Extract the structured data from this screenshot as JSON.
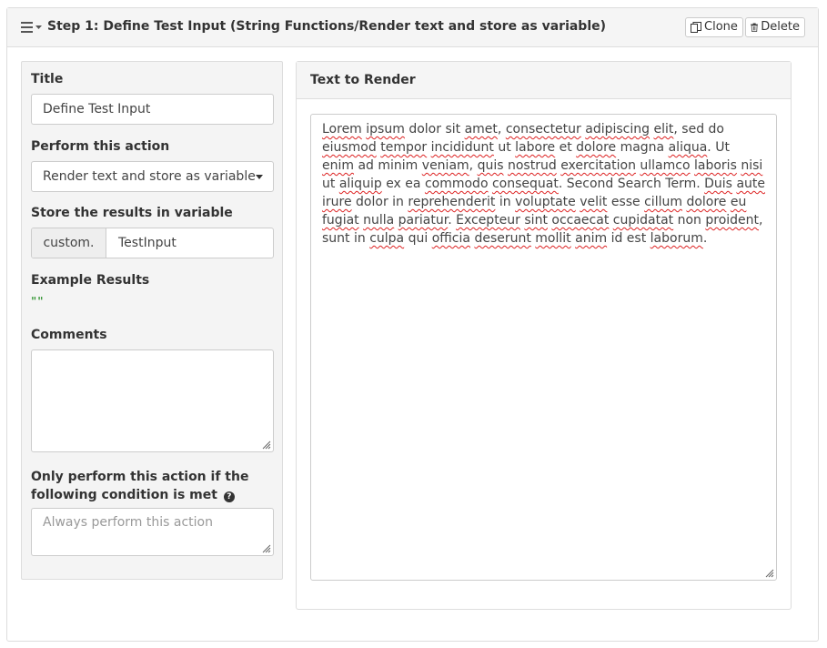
{
  "header": {
    "step_title": "Step 1: Define Test Input (String Functions/Render text and store as variable)",
    "clone_label": "Clone",
    "delete_label": "Delete"
  },
  "form": {
    "title_label": "Title",
    "title_value": "Define Test Input",
    "action_label": "Perform this action",
    "action_value": "Render text and store as variable",
    "store_label": "Store the results in variable",
    "store_prefix": "custom.",
    "store_value": "TestInput",
    "example_label": "Example Results",
    "example_value": "\"\"",
    "comments_label": "Comments",
    "comments_value": "",
    "condition_label_line1": "Only perform this action if the",
    "condition_label_line2": "following condition is met",
    "condition_placeholder": "Always perform this action"
  },
  "render": {
    "header": "Text to Render",
    "text": "Lorem ipsum dolor sit amet, consectetur adipiscing elit, sed do eiusmod tempor incididunt ut labore et dolore magna aliqua. Ut enim ad minim veniam, quis nostrud exercitation ullamco laboris nisi ut aliquip ex ea commodo consequat. Second Search Term. Duis aute irure dolor in reprehenderit in voluptate velit esse cillum dolore eu fugiat nulla pariatur. Excepteur sint occaecat cupidatat non proident, sunt in culpa qui officia deserunt mollit anim id est laborum."
  },
  "icons": {
    "menu": "hamburger-icon",
    "menu_caret": "caret-down-icon",
    "clone": "copy-icon",
    "delete": "trash-icon",
    "help": "question-circle-icon",
    "resize": "resize-grip-icon"
  },
  "colors": {
    "example_value": "#3c9a3c",
    "spellcheck_underline": "#dd2222"
  }
}
